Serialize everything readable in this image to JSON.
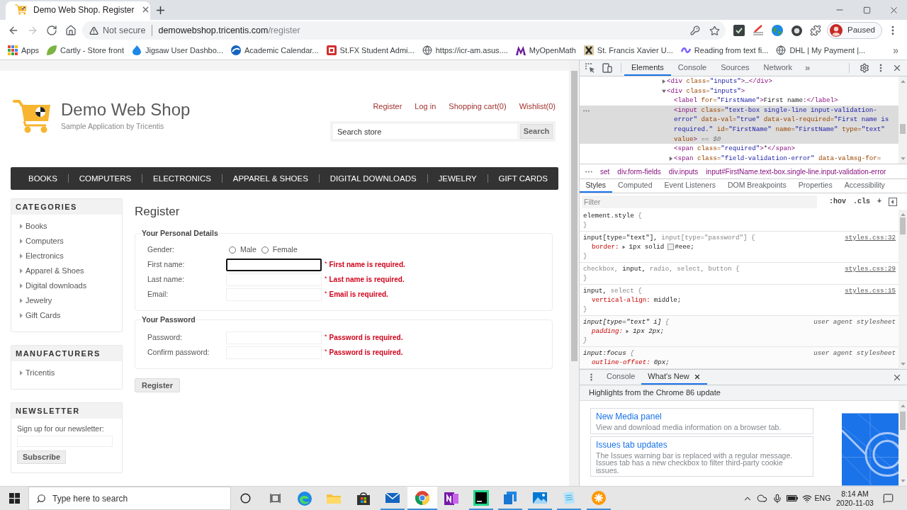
{
  "browser": {
    "tabs": [
      {
        "title": "Demo Web Shop. Register",
        "selected": true
      }
    ],
    "address": {
      "security": "Not secure",
      "host": "demowebshop.tricentis.com",
      "path": "/register"
    },
    "profile": {
      "label": "Paused"
    },
    "bookmarks": [
      "Apps",
      "Cartly - Store front",
      "Jigsaw User Dashbo...",
      "Academic Calendar...",
      "St.FX Student Admi...",
      "https://icr-am.asus....",
      "MyOpenMath",
      "St. Francis Xavier U...",
      "Reading from text fi...",
      "DHL | My Payment |..."
    ],
    "bookmarks_more": "»"
  },
  "page": {
    "logo": {
      "title": "Demo Web Shop",
      "subtitle": "Sample Application by Tricentis"
    },
    "header_links": [
      "Register",
      "Log in",
      "Shopping cart(0)",
      "Wishlist(0)"
    ],
    "search": {
      "value": "Search store",
      "button": "Search"
    },
    "menu": [
      "BOOKS",
      "COMPUTERS",
      "ELECTRONICS",
      "APPAREL & SHOES",
      "DIGITAL DOWNLOADS",
      "JEWELRY",
      "GIFT CARDS"
    ],
    "sidebar": [
      {
        "kind": "list",
        "title": "CATEGORIES",
        "items": [
          "Books",
          "Computers",
          "Electronics",
          "Apparel & Shoes",
          "Digital downloads",
          "Jewelry",
          "Gift Cards"
        ]
      },
      {
        "kind": "list",
        "title": "MANUFACTURERS",
        "items": [
          "Tricentis"
        ]
      },
      {
        "kind": "newsletter",
        "title": "NEWSLETTER",
        "label": "Sign up for our newsletter:",
        "button": "Subscribe"
      }
    ],
    "form": {
      "title": "Register",
      "sections": [
        {
          "legend": "Your Personal Details",
          "fields": [
            {
              "kind": "radio",
              "label": "Gender:",
              "options": [
                {
                  "label": "Male",
                  "selected": false
                },
                {
                  "label": "Female",
                  "selected": false
                }
              ]
            },
            {
              "kind": "text",
              "label": "First name:",
              "focused": true,
              "required_mark": "*",
              "error": "First name is required."
            },
            {
              "kind": "text",
              "label": "Last name:",
              "focused": false,
              "required_mark": "*",
              "error": "Last name is required."
            },
            {
              "kind": "text",
              "label": "Email:",
              "focused": false,
              "required_mark": "*",
              "error": "Email is required."
            }
          ]
        },
        {
          "legend": "Your Password",
          "fields": [
            {
              "kind": "password",
              "label": "Password:",
              "focused": false,
              "required_mark": "*",
              "error": "Password is required."
            },
            {
              "kind": "password",
              "label": "Confirm password:",
              "focused": false,
              "required_mark": "*",
              "error": "Password is required."
            }
          ]
        }
      ],
      "submit": "Register"
    }
  },
  "devtools": {
    "tabs": [
      {
        "label": "Elements",
        "selected": true
      },
      {
        "label": "Console",
        "selected": false
      },
      {
        "label": "Sources",
        "selected": false
      },
      {
        "label": "Network",
        "selected": false
      }
    ],
    "more_tabs": "»",
    "dom": [
      {
        "expanded": false,
        "selected": false,
        "tokens": [
          {
            "kind": "tag",
            "text": "<div"
          },
          {
            "kind": "attr",
            "text": "class="
          },
          {
            "kind": "value",
            "text": "\"inputs\""
          },
          {
            "kind": "tag",
            "text": ">"
          },
          {
            "kind": "text",
            "text": "…"
          },
          {
            "kind": "tag",
            "text": "</div>"
          }
        ]
      },
      {
        "expanded": true,
        "selected": false,
        "tokens": [
          {
            "kind": "tag",
            "text": "<div"
          },
          {
            "kind": "attr",
            "text": "class="
          },
          {
            "kind": "value",
            "text": "\"inputs\""
          },
          {
            "kind": "tag",
            "text": ">"
          }
        ],
        "children": [
          {
            "selected": false,
            "tokens": [
              {
                "kind": "tag",
                "text": "<label"
              },
              {
                "kind": "attr",
                "text": "for="
              },
              {
                "kind": "value",
                "text": "\"FirstName\""
              },
              {
                "kind": "tag",
                "text": ">"
              },
              {
                "kind": "text",
                "text": "First name:"
              },
              {
                "kind": "tag",
                "text": "</label>"
              }
            ]
          },
          {
            "selected": true,
            "tokens": [
              {
                "kind": "tag",
                "text": "<input"
              },
              {
                "kind": "attr",
                "text": "class="
              },
              {
                "kind": "value",
                "text": "\"text-box single-line input-validation-error\""
              },
              {
                "kind": "attr",
                "text": "data-val="
              },
              {
                "kind": "value",
                "text": "\"true\""
              },
              {
                "kind": "attr",
                "text": "data-val-required="
              },
              {
                "kind": "value",
                "text": "\"First name is required.\""
              },
              {
                "kind": "attr",
                "text": "id="
              },
              {
                "kind": "value",
                "text": "\"FirstName\""
              },
              {
                "kind": "attr",
                "text": "name="
              },
              {
                "kind": "value",
                "text": "\"FirstName\""
              },
              {
                "kind": "attr",
                "text": "type="
              },
              {
                "kind": "value",
                "text": "\"text\""
              },
              {
                "kind": "attr",
                "text": "value"
              },
              {
                "kind": "tag",
                "text": ">"
              },
              {
                "kind": "marker",
                "text": "== $0"
              }
            ]
          },
          {
            "selected": false,
            "tokens": [
              {
                "kind": "tag",
                "text": "<span"
              },
              {
                "kind": "attr",
                "text": "class="
              },
              {
                "kind": "value",
                "text": "\"required\""
              },
              {
                "kind": "tag",
                "text": ">"
              },
              {
                "kind": "text",
                "text": "*"
              },
              {
                "kind": "tag",
                "text": "</span>"
              }
            ]
          },
          {
            "expanded": false,
            "selected": false,
            "tokens": [
              {
                "kind": "tag",
                "text": "<span"
              },
              {
                "kind": "attr",
                "text": "class="
              },
              {
                "kind": "value",
                "text": "\"field-validation-error\""
              },
              {
                "kind": "attr",
                "text": "data-valmsg-for="
              }
            ]
          }
        ]
      }
    ],
    "breadcrumbs": [
      "set",
      "div.form-fields",
      "div.inputs",
      "input#FirstName.text-box.single-line.input-validation-error"
    ],
    "pane_tabs": [
      {
        "label": "Styles",
        "selected": true
      },
      {
        "label": "Computed",
        "selected": false
      },
      {
        "label": "Event Listeners",
        "selected": false
      },
      {
        "label": "DOM Breakpoints",
        "selected": false
      },
      {
        "label": "Properties",
        "selected": false
      },
      {
        "label": "Accessibility",
        "selected": false
      }
    ],
    "filter": {
      "placeholder": "Filter",
      "buttons": [
        ":hov",
        ".cls",
        "+"
      ]
    },
    "rules": [
      {
        "kind": "author",
        "selectors": [
          {
            "text": "element.style",
            "matched": true
          }
        ],
        "open": "{",
        "close": "}"
      },
      {
        "kind": "author",
        "selectors": [
          {
            "text": "input[type=\"text\"],",
            "matched": true
          },
          {
            "text": "input[type=\"password\"]",
            "matched": false
          }
        ],
        "open": "{",
        "source": "styles.css:32",
        "props": [
          {
            "name": "border:",
            "expandable": true,
            "value": "1px solid",
            "color": "#eeeeee",
            "color_value": "#eee;"
          }
        ],
        "close": "}"
      },
      {
        "kind": "author",
        "selectors": [
          {
            "text": "checkbox,",
            "matched": false
          },
          {
            "text": "input,",
            "matched": true
          },
          {
            "text": "radio,",
            "matched": false
          },
          {
            "text": "select,",
            "matched": false
          },
          {
            "text": "button",
            "matched": false
          }
        ],
        "open": "{",
        "source": "styles.css:29",
        "close": "}"
      },
      {
        "kind": "author",
        "selectors": [
          {
            "text": "input,",
            "matched": true
          },
          {
            "text": "select",
            "matched": false
          }
        ],
        "open": "{",
        "source": "styles.css:15",
        "props": [
          {
            "name": "vertical-align:",
            "expandable": false,
            "value": "middle;"
          }
        ],
        "close": "}"
      },
      {
        "kind": "user_agent",
        "selectors": [
          {
            "text": "input[type=\"text\" i]",
            "matched": true
          }
        ],
        "open": "{",
        "source": "user agent stylesheet",
        "props": [
          {
            "name": "padding:",
            "expandable": true,
            "value": "1px 2px;"
          }
        ],
        "close": "}"
      },
      {
        "kind": "user_agent",
        "selectors": [
          {
            "text": "input:focus",
            "matched": true
          }
        ],
        "open": "{",
        "source": "user agent stylesheet",
        "props": [
          {
            "name": "outline-offset:",
            "expandable": false,
            "value": "0px;"
          }
        ]
      }
    ],
    "drawer": {
      "tabs": [
        {
          "label": "Console",
          "selected": false,
          "closable": false
        },
        {
          "label": "What's New",
          "selected": true,
          "closable": true
        }
      ],
      "heading": "Highlights from the Chrome 86 update",
      "cards": [
        {
          "title": "New Media panel",
          "text": "View and download media information on a browser tab."
        },
        {
          "title": "Issues tab updates",
          "text": "The Issues warning bar is replaced with a regular message. Issues tab has a new checkbox to filter third-party cookie issues."
        }
      ]
    }
  },
  "taskbar": {
    "search": {
      "placeholder": "Type here to search"
    },
    "apps": [
      {
        "running": false,
        "selected": false
      },
      {
        "running": false,
        "selected": false
      },
      {
        "running": false,
        "selected": false
      },
      {
        "running": true,
        "selected": false
      },
      {
        "running": true,
        "selected": true
      },
      {
        "running": false,
        "selected": false
      },
      {
        "running": true,
        "selected": false
      },
      {
        "running": true,
        "selected": false
      },
      {
        "running": true,
        "selected": false
      },
      {
        "running": true,
        "selected": false
      },
      {
        "running": true,
        "selected": false
      }
    ],
    "language": "ENG",
    "time": "8:14 AM",
    "date": "2020-11-03"
  }
}
